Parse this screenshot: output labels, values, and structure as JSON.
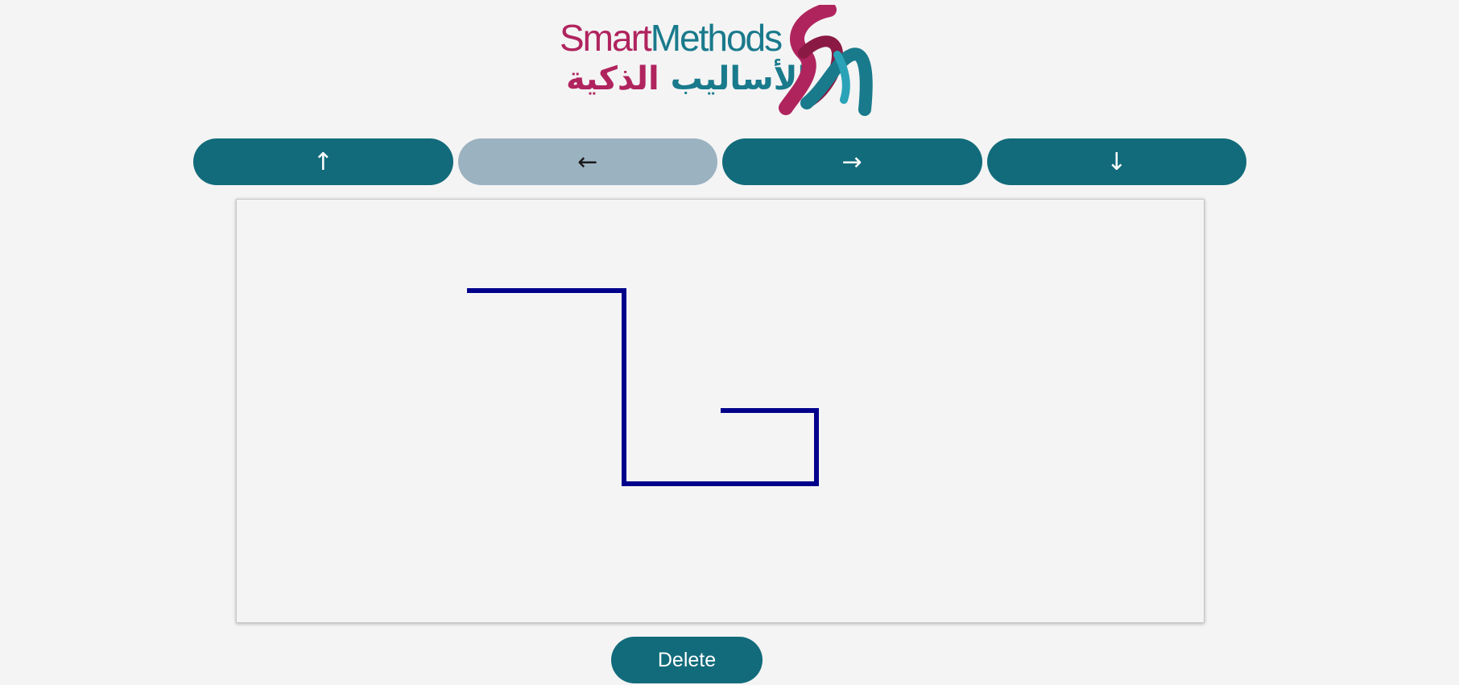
{
  "logo": {
    "text_en_part1": "Smart",
    "text_en_part2": "Methods",
    "text_ar_part1": "الأساليب",
    "text_ar_part2": "الذكية",
    "brand_colors": {
      "magenta": "#b0245e",
      "teal": "#197a8c"
    }
  },
  "controls": {
    "up_label": "↑",
    "left_label": "←",
    "right_label": "→",
    "down_label": "↓",
    "inactive_button": "left"
  },
  "drawing": {
    "line_color": "#00008b",
    "background": "#f4f4f4"
  },
  "actions": {
    "delete_label": "Delete"
  },
  "colors": {
    "button": "#126b7b",
    "button_inactive": "#9bb2c0",
    "page_background": "#f4f4f4"
  }
}
